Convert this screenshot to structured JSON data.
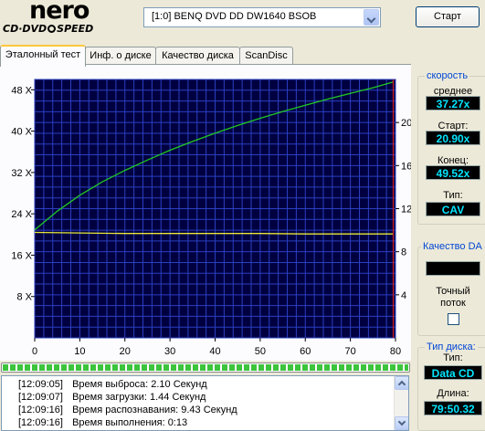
{
  "app": {
    "logo_text": "nero",
    "logo_sub_left": "CD·DVD",
    "logo_sub_right": "SPEED"
  },
  "drive": {
    "selected": "[1:0]  BENQ DVD DD DW1640 BSOB"
  },
  "start_button": "Старт",
  "tabs": [
    {
      "label": "Эталонный тест",
      "active": true
    },
    {
      "label": "Инф. о диске",
      "active": false
    },
    {
      "label": "Качество диска",
      "active": false
    },
    {
      "label": "ScanDisc",
      "active": false
    }
  ],
  "chart_data": {
    "type": "line",
    "x_ticks": [
      "0",
      "10",
      "20",
      "30",
      "40",
      "50",
      "60",
      "70",
      "80"
    ],
    "y_left_ticks": [
      "8 X",
      "16 X",
      "24 X",
      "32 X",
      "40 X",
      "48 X"
    ],
    "y_right_ticks": [
      "4",
      "8",
      "12",
      "16",
      "20"
    ],
    "xlim": [
      0,
      80
    ],
    "ylim_left": [
      0,
      50
    ],
    "ylim_right": [
      0,
      24
    ],
    "grid": true,
    "colors": {
      "background": "#000040",
      "grid": "#2b3fc0",
      "speed": "#22c822",
      "access": "#e8e838",
      "marker": "#d02020"
    },
    "series": [
      {
        "axis": "left",
        "x": [
          0,
          5,
          10,
          15,
          20,
          25,
          30,
          35,
          40,
          45,
          50,
          55,
          60,
          65,
          70,
          75,
          79.5
        ],
        "y": [
          20.9,
          24.5,
          27.6,
          30.2,
          32.4,
          34.4,
          36.3,
          38.0,
          39.6,
          41.1,
          42.5,
          43.8,
          45.0,
          46.2,
          47.3,
          48.4,
          49.5
        ]
      },
      {
        "axis": "left",
        "x": [
          0,
          10,
          20,
          30,
          40,
          50,
          60,
          70,
          79.5
        ],
        "y": [
          20.4,
          20.3,
          20.2,
          20.2,
          20.2,
          20.2,
          20.1,
          20.1,
          20.1
        ]
      }
    ],
    "marker_x": 79.5
  },
  "progress": {
    "percent": 100
  },
  "log": [
    {
      "time": "[12:09:05]",
      "text": "Время выброса: 2.10 Секунд"
    },
    {
      "time": "[12:09:07]",
      "text": "Время загрузки: 1.44 Секунд"
    },
    {
      "time": "[12:09:16]",
      "text": "Время распознавания: 9.43 Секунд"
    },
    {
      "time": "[12:09:16]",
      "text": "Время выполнения:  0:13"
    }
  ],
  "speed_panel": {
    "title": "скорость",
    "avg_label": "среднее",
    "avg_value": "37.27x",
    "start_label": "Старт:",
    "start_value": "20.90x",
    "end_label": "Конец:",
    "end_value": "49.52x",
    "type_label": "Тип:",
    "type_value": "CAV"
  },
  "quality_panel": {
    "title": "Качество DA",
    "accurate_stream_label_1": "Точный",
    "accurate_stream_label_2": "поток",
    "accurate_stream_checked": false
  },
  "disc_panel": {
    "title": "Тип диска:",
    "type_label": "Тип:",
    "type_value": "Data CD",
    "length_label": "Длина:",
    "length_value": "79:50.32"
  }
}
